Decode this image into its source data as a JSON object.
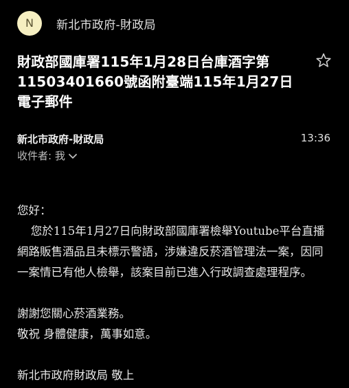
{
  "header": {
    "avatar_letter": "N",
    "sender_name": "新北市政府-財政局"
  },
  "email": {
    "subject": "財政部國庫署115年1月28日台庫酒字第11503401660號函附臺端115年1月27日電子郵件",
    "from": "新北市政府-財政局",
    "time": "13:36",
    "recipient_label": "收件者: 我",
    "body": {
      "greeting": "您好：",
      "paragraph": "您於115年1月27日向財政部國庫署檢舉Youtube平台直播網路販售酒品且未標示警語，涉嫌違反菸酒管理法一案，因同一案情已有他人檢舉，該案目前已進入行政調查處理程序。",
      "thanks": "謝謝您關心菸酒業務。",
      "wishes": "敬祝 身體健康，萬事如意。",
      "signature": "新北市政府財政局 敬上"
    }
  },
  "colors": {
    "background": "#000000",
    "avatar_bg": "#f6efc1",
    "text": "#e6e6e6"
  },
  "icons": {
    "star": "star-icon",
    "chevron": "chevron-down-icon"
  }
}
